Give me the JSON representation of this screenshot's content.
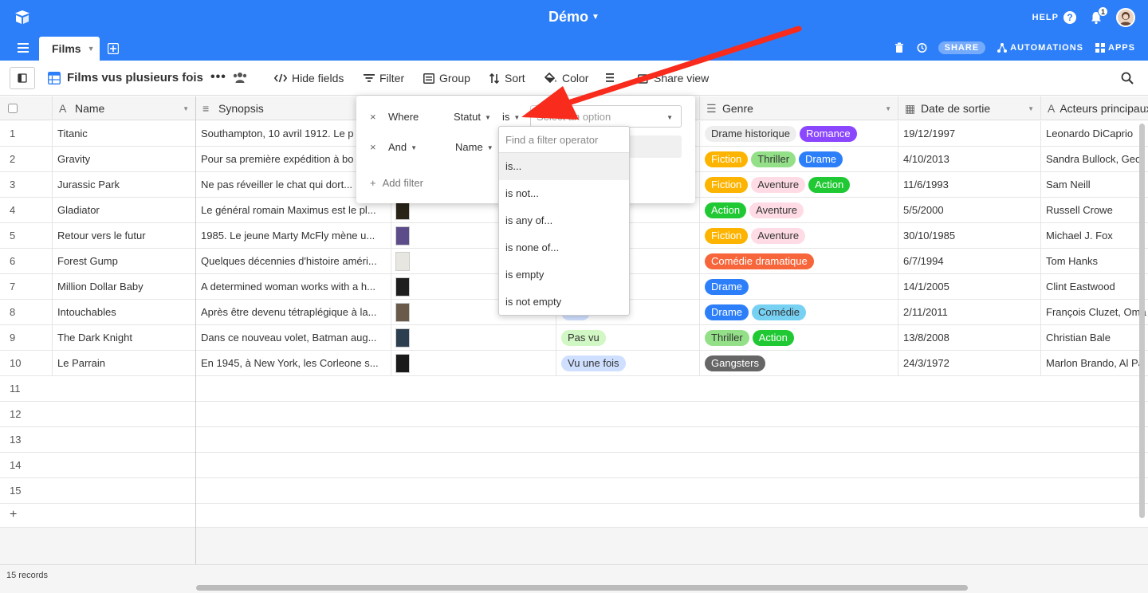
{
  "topbar": {
    "base_title": "Démo",
    "help_label": "HELP",
    "help_icon": "?",
    "notification_count": "1"
  },
  "tabs": {
    "active_tab": "Films",
    "share_label": "SHARE",
    "automations_label": "AUTOMATIONS",
    "apps_label": "APPS"
  },
  "view": {
    "name": "Films vus plusieurs fois",
    "more_label": "•••",
    "tools": {
      "hide_fields": "Hide fields",
      "filter": "Filter",
      "group": "Group",
      "sort": "Sort",
      "color": "Color",
      "share_view": "Share view"
    }
  },
  "columns": {
    "name": "Name",
    "synopsis": "Synopsis",
    "genre": "Genre",
    "date": "Date de sortie",
    "actors": "Acteurs principaux"
  },
  "rows": [
    {
      "num": "1",
      "name": "Titanic",
      "synopsis": "Southampton, 10 avril 1912. Le p",
      "status": "",
      "genres": [
        "Drame historique",
        "Romance"
      ],
      "date": "19/12/1997",
      "actors": "Leonardo DiCaprio"
    },
    {
      "num": "2",
      "name": "Gravity",
      "synopsis": "Pour sa première expédition à bo",
      "status": "",
      "genres": [
        "Fiction",
        "Thriller",
        "Drame"
      ],
      "date": "4/10/2013",
      "actors": "Sandra Bullock, Geor"
    },
    {
      "num": "3",
      "name": "Jurassic Park",
      "synopsis": "Ne pas réveiller le chat qui dort...",
      "status": "",
      "genres": [
        "Fiction",
        "Aventure",
        "Action"
      ],
      "date": "11/6/1993",
      "actors": "Sam Neill"
    },
    {
      "num": "4",
      "name": "Gladiator",
      "synopsis": "Le général romain Maximus est le pl...",
      "status": "fois",
      "genres": [
        "Action",
        "Aventure"
      ],
      "date": "5/5/2000",
      "actors": "Russell Crowe"
    },
    {
      "num": "5",
      "name": "Retour vers le futur",
      "synopsis": "1985. Le jeune Marty McFly mène u...",
      "status": "fois",
      "genres": [
        "Fiction",
        "Aventure"
      ],
      "date": "30/10/1985",
      "actors": "Michael J. Fox"
    },
    {
      "num": "6",
      "name": "Forest Gump",
      "synopsis": "Quelques décennies d'histoire améri...",
      "status": "",
      "genres": [
        "Comédie dramatique"
      ],
      "date": "6/7/1994",
      "actors": "Tom Hanks"
    },
    {
      "num": "7",
      "name": "Million Dollar Baby",
      "synopsis": "A determined woman works with a h...",
      "status": "",
      "genres": [
        "Drame"
      ],
      "date": "14/1/2005",
      "actors": "Clint Eastwood"
    },
    {
      "num": "8",
      "name": "Intouchables",
      "synopsis": "Après être devenu tétraplégique à la...",
      "status": "fois",
      "genres": [
        "Drame",
        "Comédie"
      ],
      "date": "2/11/2011",
      "actors": "François Cluzet, Oma"
    },
    {
      "num": "9",
      "name": "The Dark Knight",
      "synopsis": "Dans ce nouveau volet, Batman aug...",
      "status": "Pas vu",
      "genres": [
        "Thriller",
        "Action"
      ],
      "date": "13/8/2008",
      "actors": "Christian Bale"
    },
    {
      "num": "10",
      "name": "Le Parrain",
      "synopsis": "En 1945, à New York, les Corleone s...",
      "status": "Vu une fois",
      "genres": [
        "Gangsters"
      ],
      "date": "24/3/1972",
      "actors": "Marlon Brando, Al Pa"
    }
  ],
  "empty_rows": [
    "11",
    "12",
    "13",
    "14",
    "15"
  ],
  "add_row_label": "+",
  "footer": {
    "records": "15 records"
  },
  "filter": {
    "row1": {
      "remove": "×",
      "conj": "Where",
      "field": "Statut",
      "op": "is",
      "value_placeholder": "Select an option"
    },
    "row2": {
      "remove": "×",
      "conj": "And",
      "field": "Name"
    },
    "add_filter": "Add filter"
  },
  "operator_menu": {
    "search_placeholder": "Find a filter operator",
    "items": [
      "is...",
      "is not...",
      "is any of...",
      "is none of...",
      "is empty",
      "is not empty"
    ]
  },
  "genre_colors": {
    "Drame historique": "#eeeeee",
    "Romance": "#8b46ff",
    "Fiction": "#fcb400",
    "Thriller": "#93e088",
    "Drame": "#2d7ff9",
    "Aventure": "#ffdce5",
    "Action": "#20c933",
    "Comédie dramatique": "#f7653b",
    "Comédie": "#77d1f3",
    "Gangsters": "#666666"
  },
  "status_colors": {
    "Pas vu": "#d1f7c4",
    "Vu une fois": "#cfdfff",
    "fois": "#cfdfff"
  },
  "accent_color": "#2d7ff9",
  "annotation_color": "#f82b1c"
}
